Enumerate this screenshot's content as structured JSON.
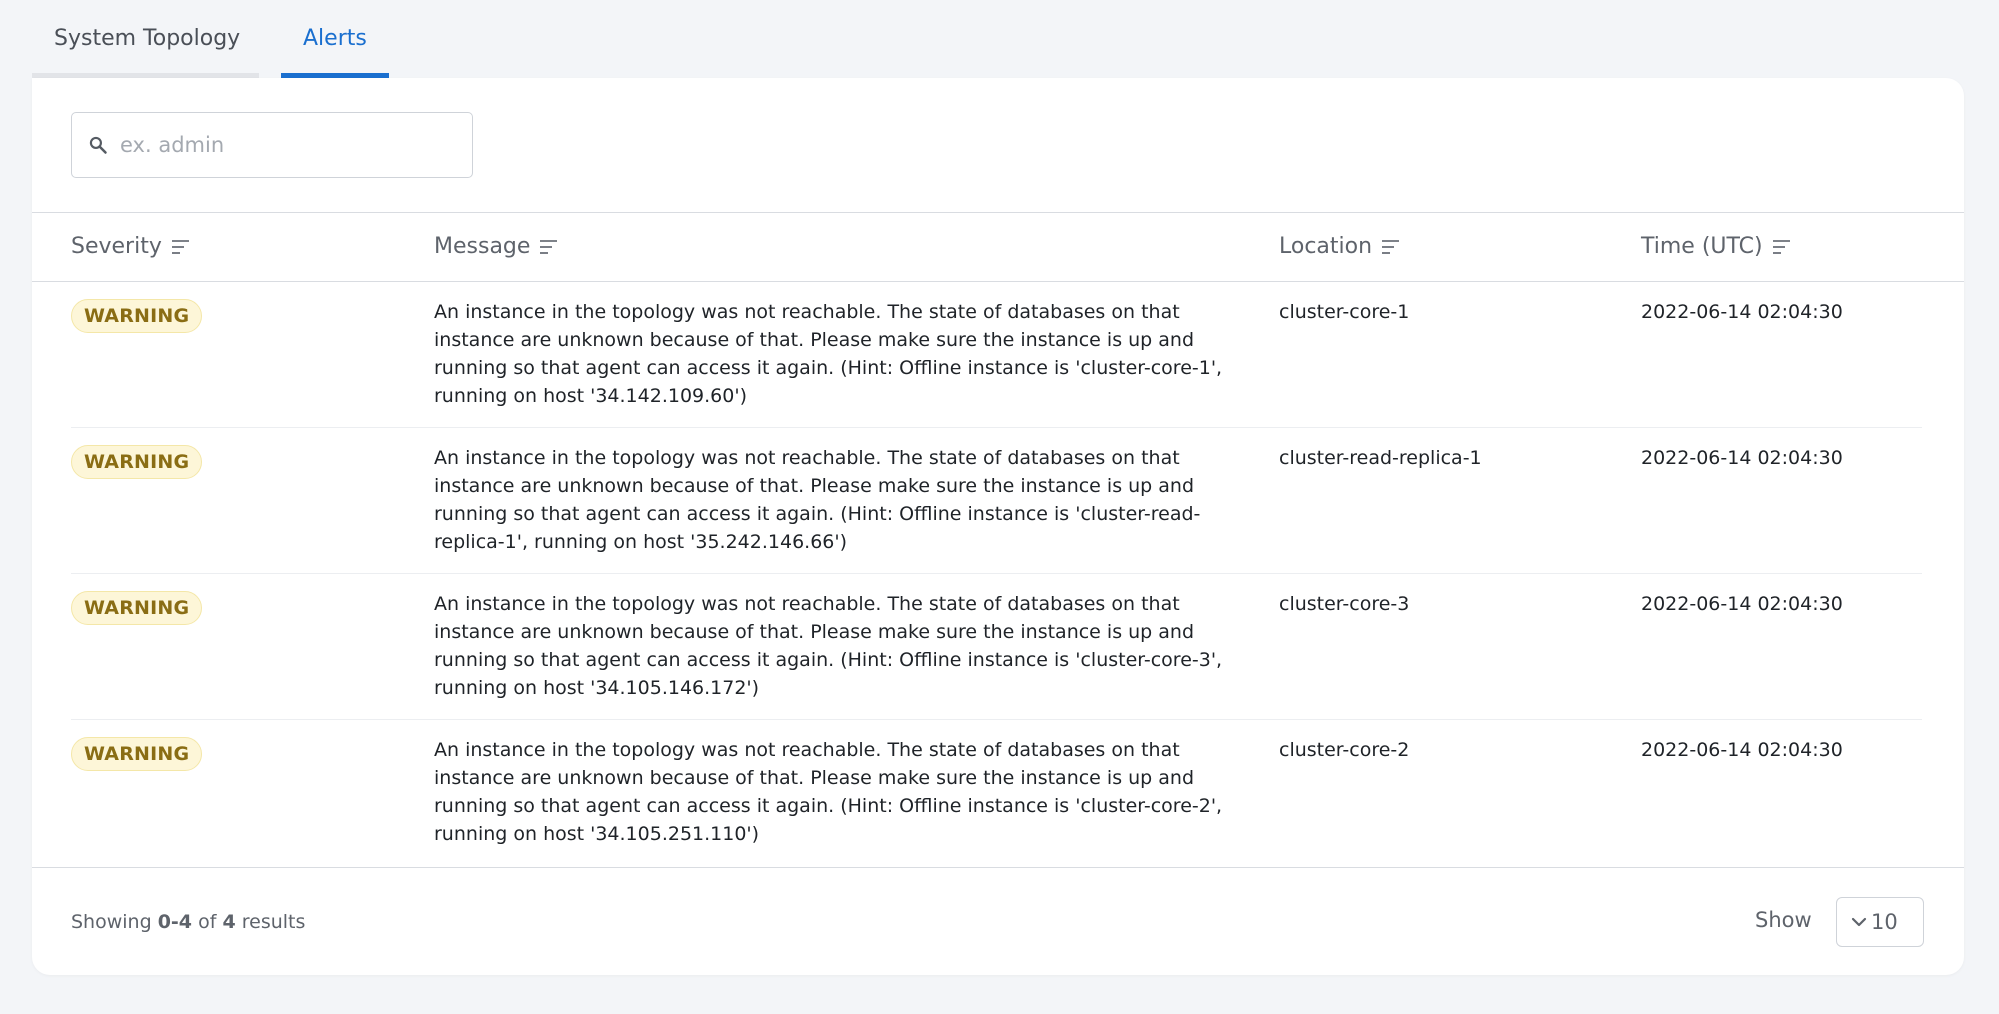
{
  "tabs": [
    {
      "label": "System Topology",
      "active": false
    },
    {
      "label": "Alerts",
      "active": true
    }
  ],
  "search": {
    "placeholder": "ex. admin",
    "value": ""
  },
  "table": {
    "columns": [
      "Severity",
      "Message",
      "Location",
      "Time (UTC)"
    ],
    "rows": [
      {
        "severity": "WARNING",
        "message": "An instance in the topology was not reachable. The state of databases on that instance are unknown because of that. Please make sure the instance is up and running so that agent can access it again. (Hint: Offline instance is 'cluster-core-1', running on host '34.142.109.60')",
        "location": "cluster-core-1",
        "time": "2022-06-14 02:04:30"
      },
      {
        "severity": "WARNING",
        "message": "An instance in the topology was not reachable. The state of databases on that instance are unknown because of that. Please make sure the instance is up and running so that agent can access it again. (Hint: Offline instance is 'cluster-read-replica-1', running on host '35.242.146.66')",
        "location": "cluster-read-replica-1",
        "time": "2022-06-14 02:04:30"
      },
      {
        "severity": "WARNING",
        "message": "An instance in the topology was not reachable. The state of databases on that instance are unknown because of that. Please make sure the instance is up and running so that agent can access it again. (Hint: Offline instance is 'cluster-core-3', running on host '34.105.146.172')",
        "location": "cluster-core-3",
        "time": "2022-06-14 02:04:30"
      },
      {
        "severity": "WARNING",
        "message": "An instance in the topology was not reachable. The state of databases on that instance are unknown because of that. Please make sure the instance is up and running so that agent can access it again. (Hint: Offline instance is 'cluster-core-2', running on host '34.105.251.110')",
        "location": "cluster-core-2",
        "time": "2022-06-14 02:04:30"
      }
    ]
  },
  "footer": {
    "showing_prefix": "Showing",
    "range": "0-4",
    "of_word": "of",
    "total": "4",
    "results_word": "results",
    "show_label": "Show",
    "page_size": "10"
  },
  "colors": {
    "accent": "#1a6fcf",
    "warning_bg": "#fdf6d8",
    "warning_text": "#8a6d14"
  },
  "icons": {
    "search": "search-icon",
    "sort": "sort-lines-icon",
    "dropdown": "chevron-down-icon"
  }
}
